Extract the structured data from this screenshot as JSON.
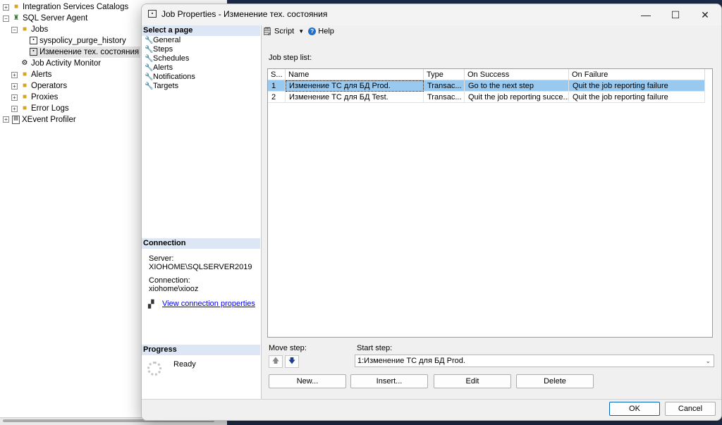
{
  "explorer": {
    "items": [
      {
        "label": "Integration Services Catalogs",
        "expander": "+",
        "icon": "folder-icon"
      },
      {
        "label": "SQL Server Agent",
        "expander": "−",
        "icon": "agent-icon"
      },
      {
        "label": "Jobs",
        "expander": "−",
        "icon": "folder-icon"
      },
      {
        "label": "syspolicy_purge_history",
        "expander": "",
        "icon": "job-icon"
      },
      {
        "label": "Изменение тех. состояния",
        "expander": "",
        "icon": "job-icon"
      },
      {
        "label": "Job Activity Monitor",
        "expander": "",
        "icon": "monitor-icon"
      },
      {
        "label": "Alerts",
        "expander": "+",
        "icon": "folder-icon"
      },
      {
        "label": "Operators",
        "expander": "+",
        "icon": "folder-icon"
      },
      {
        "label": "Proxies",
        "expander": "+",
        "icon": "folder-icon"
      },
      {
        "label": "Error Logs",
        "expander": "+",
        "icon": "folder-icon"
      },
      {
        "label": "XEvent Profiler",
        "expander": "+",
        "icon": "profiler-icon"
      }
    ]
  },
  "dialog": {
    "title": "Job Properties - Изменение тех. состояния",
    "window_buttons": {
      "minimize": "—",
      "maximize": "☐",
      "close": "✕"
    },
    "select_page": {
      "header": "Select a page",
      "items": [
        "General",
        "Steps",
        "Schedules",
        "Alerts",
        "Notifications",
        "Targets"
      ]
    },
    "connection": {
      "header": "Connection",
      "server_label": "Server:",
      "server_value": "XIOHOME\\SQLSERVER2019",
      "connection_label": "Connection:",
      "connection_value": "xiohome\\xiooz",
      "view_link": "View connection properties"
    },
    "progress": {
      "header": "Progress",
      "status": "Ready"
    },
    "toolbar": {
      "script_label": "Script",
      "script_dropdown": "▼",
      "help_label": "Help"
    },
    "step_list": {
      "label": "Job step list:",
      "columns": [
        "S...",
        "Name",
        "Type",
        "On Success",
        "On Failure"
      ],
      "rows": [
        [
          "1",
          "Изменение ТС для БД Prod.",
          "Transac...",
          "Go to the next step",
          "Quit the job reporting failure"
        ],
        [
          "2",
          "Изменение ТС для БД Test.",
          "Transac...",
          "Quit the job reporting succe...",
          "Quit the job reporting failure"
        ]
      ]
    },
    "move_step": {
      "label": "Move step:",
      "up": "🡅",
      "down": "🡇"
    },
    "start_step": {
      "label": "Start step:",
      "value": "1:Изменение ТС для БД Prod."
    },
    "buttons": {
      "new": "New...",
      "insert": "Insert...",
      "edit": "Edit",
      "delete": "Delete"
    },
    "footer": {
      "ok": "OK",
      "cancel": "Cancel"
    }
  }
}
